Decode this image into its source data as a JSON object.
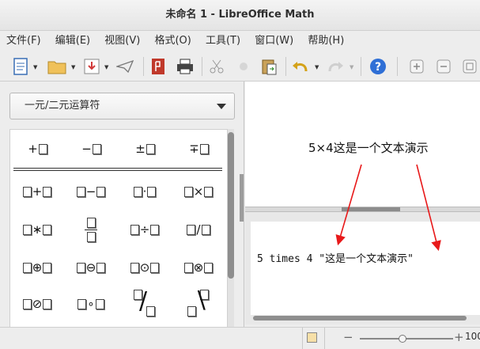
{
  "window": {
    "title": "未命名 1 - LibreOffice Math"
  },
  "menu": [
    "文件(F)",
    "编辑(E)",
    "视图(V)",
    "格式(O)",
    "工具(T)",
    "窗口(W)",
    "帮助(H)"
  ],
  "toolbar_icons": [
    "new-document-icon",
    "open-folder-icon",
    "save-icon",
    "send-icon",
    "export-pdf-icon",
    "print-icon",
    "cut-icon",
    "copy-icon",
    "paste-icon",
    "undo-icon",
    "redo-icon",
    "help-icon",
    "zoom-in-icon",
    "zoom-out-icon",
    "zoom-100-icon"
  ],
  "sidebar": {
    "category": "一元/二元运算符",
    "palette": [
      {
        "row": 0,
        "items": [
          [
            "",
            "+"
          ],
          [
            "",
            "−"
          ],
          [
            "",
            "±"
          ],
          [
            "",
            "∓"
          ]
        ]
      },
      {
        "row": 1,
        "items": [
          [
            "b",
            "+"
          ],
          [
            "b",
            "−"
          ],
          [
            "b",
            "·"
          ],
          [
            "b",
            "×"
          ]
        ]
      },
      {
        "row": 2,
        "items": [
          [
            "b",
            "∗"
          ],
          [
            "frac",
            ""
          ],
          [
            "b",
            "÷"
          ],
          [
            "b",
            "/"
          ]
        ]
      },
      {
        "row": 3,
        "items": [
          [
            "b",
            "⊕"
          ],
          [
            "b",
            "⊖"
          ],
          [
            "b",
            "⊙"
          ],
          [
            "b",
            "⊗"
          ]
        ]
      },
      {
        "row": 4,
        "items": [
          [
            "b",
            "⊘"
          ],
          [
            "b",
            "∘"
          ],
          [
            "wide",
            "/"
          ],
          [
            "wide",
            "∖"
          ]
        ]
      }
    ]
  },
  "preview": {
    "formula": "5×4这是一个文本演示"
  },
  "editor": {
    "command": "5 times 4 \"这是一个文本演示\""
  },
  "status": {
    "zoom": "100"
  },
  "colors": {
    "annotation_arrow": "#e8191a",
    "help_icon": "#2f6fd6",
    "pdf_icon": "#c0392b"
  }
}
